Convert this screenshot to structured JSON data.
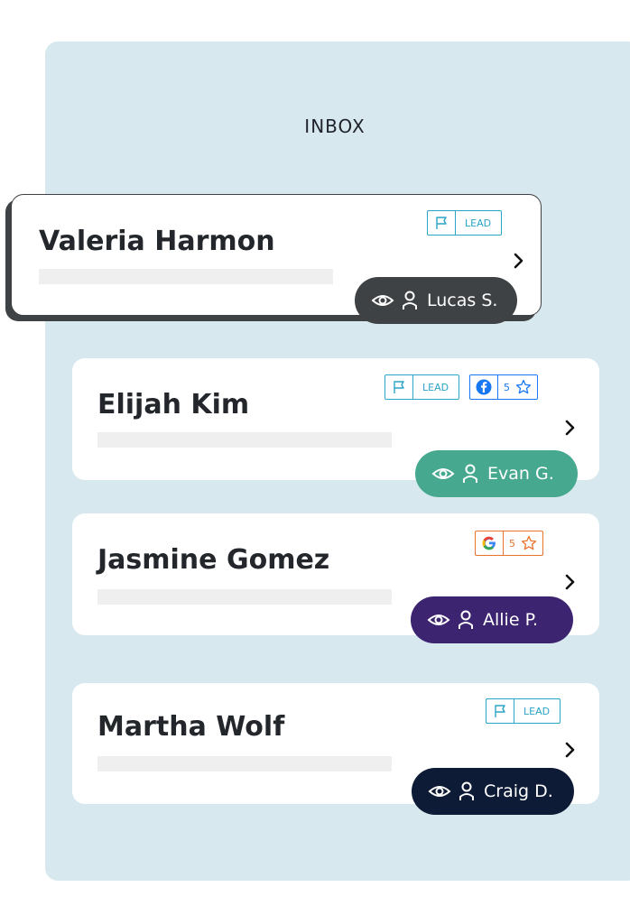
{
  "inbox": {
    "title": "INBOX"
  },
  "colors": {
    "panel_bg": "#d7e9ef",
    "lead_badge": "#2aa4c7",
    "facebook": "#1877f2",
    "google_accent": "#e8742c"
  },
  "conversations": [
    {
      "name": "Valeria Harmon",
      "selected": true,
      "badges": [
        {
          "type": "lead",
          "icon": "flag-icon",
          "label": "LEAD"
        }
      ],
      "assignee": {
        "name": "Lucas S.",
        "color": "#3f4244"
      }
    },
    {
      "name": "Elijah Kim",
      "selected": false,
      "badges": [
        {
          "type": "lead",
          "icon": "flag-icon",
          "label": "LEAD"
        },
        {
          "type": "review",
          "source": "facebook-icon",
          "count": "5",
          "icon": "star-icon"
        }
      ],
      "assignee": {
        "name": "Evan G.",
        "color": "#45a88f"
      }
    },
    {
      "name": "Jasmine Gomez",
      "selected": false,
      "badges": [
        {
          "type": "review",
          "source": "google-icon",
          "count": "5",
          "icon": "star-icon"
        }
      ],
      "assignee": {
        "name": "Allie P.",
        "color": "#3d2470"
      }
    },
    {
      "name": "Martha Wolf",
      "selected": false,
      "badges": [
        {
          "type": "lead",
          "icon": "flag-icon",
          "label": "LEAD"
        }
      ],
      "assignee": {
        "name": "Craig D.",
        "color": "#0e1b36"
      }
    }
  ]
}
